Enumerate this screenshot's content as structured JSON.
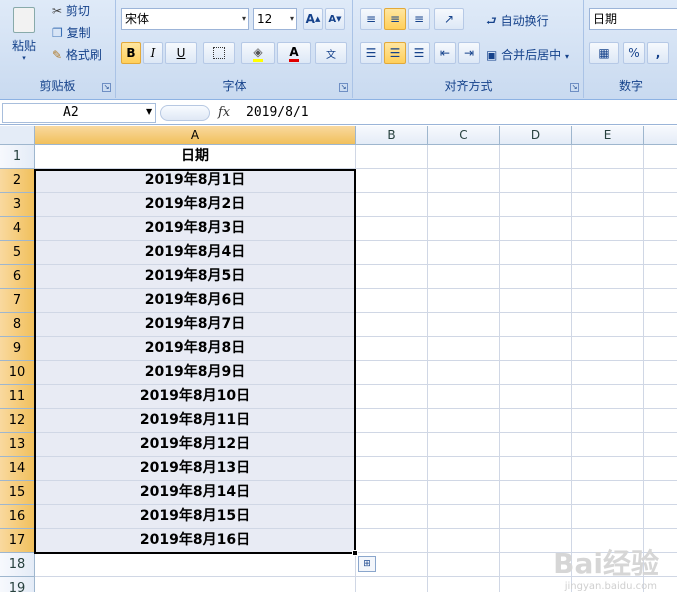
{
  "ribbon": {
    "clipboard": {
      "paste": "粘贴",
      "cut": "剪切",
      "copy": "复制",
      "format_painter": "格式刷",
      "label": "剪贴板"
    },
    "font": {
      "name": "宋体",
      "size": "12",
      "bold": "B",
      "italic": "I",
      "underline": "U",
      "font_color": "A",
      "label": "字体"
    },
    "alignment": {
      "wrap_text": "自动换行",
      "merge_center": "合并后居中",
      "label": "对齐方式"
    },
    "number": {
      "format": "日期",
      "percent": "%",
      "comma": ",",
      "label": "数字"
    }
  },
  "formula_bar": {
    "name_box": "A2",
    "fx": "fx",
    "value": "2019/8/1"
  },
  "grid": {
    "columns": [
      "A",
      "B",
      "C",
      "D",
      "E"
    ],
    "rows": [
      "1",
      "2",
      "3",
      "4",
      "5",
      "6",
      "7",
      "8",
      "9",
      "10",
      "11",
      "12",
      "13",
      "14",
      "15",
      "16",
      "17",
      "18",
      "19"
    ],
    "header": "日期",
    "cells": [
      "2019年8月1日",
      "2019年8月2日",
      "2019年8月3日",
      "2019年8月4日",
      "2019年8月5日",
      "2019年8月6日",
      "2019年8月7日",
      "2019年8月8日",
      "2019年8月9日",
      "2019年8月10日",
      "2019年8月11日",
      "2019年8月12日",
      "2019年8月13日",
      "2019年8月14日",
      "2019年8月15日",
      "2019年8月16日"
    ]
  },
  "watermark": {
    "text": "Bai经验",
    "sub": "jingyan.baidu.com"
  },
  "colors": {
    "ribbon_bg": "#c9daf0",
    "selected_header": "#f1c05c",
    "selection_fill": "#e8ebf4"
  }
}
